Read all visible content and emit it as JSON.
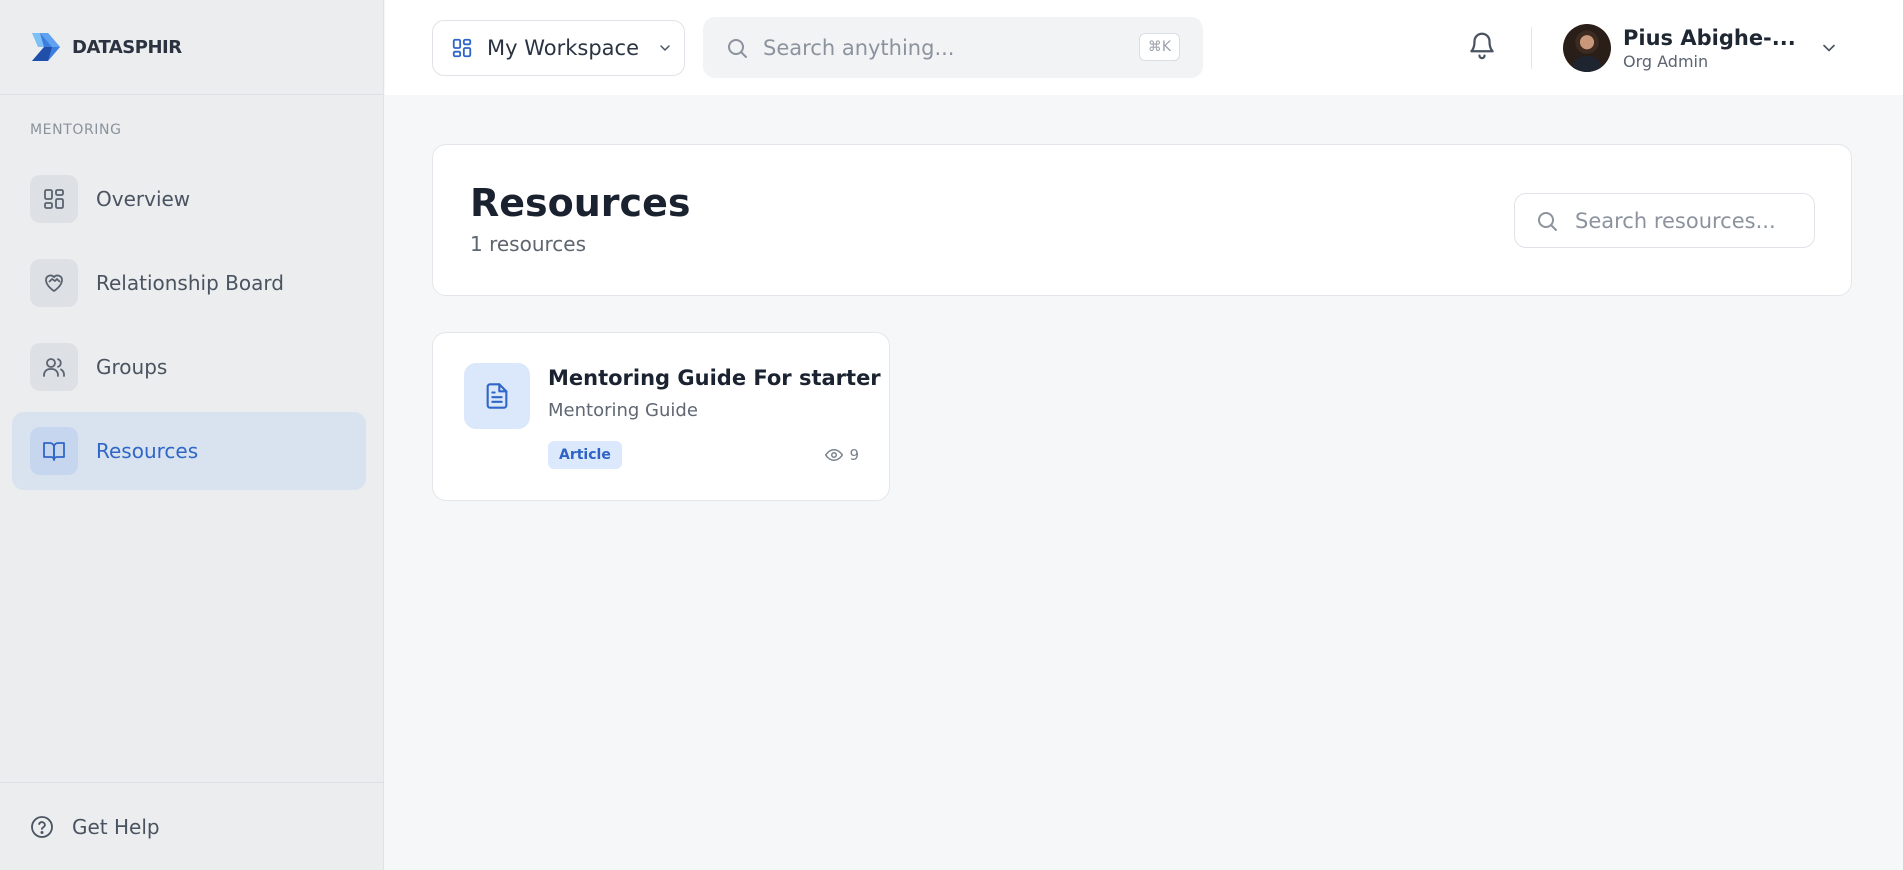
{
  "brand": {
    "name": "DATASPHIR",
    "accent": "#2f66c7"
  },
  "sidebar": {
    "section_label": "MENTORING",
    "items": [
      {
        "label": "Overview",
        "icon": "dashboard-grid-icon",
        "active": false
      },
      {
        "label": "Relationship Board",
        "icon": "heart-handshake-icon",
        "active": false
      },
      {
        "label": "Groups",
        "icon": "users-icon",
        "active": false
      },
      {
        "label": "Resources",
        "icon": "book-open-icon",
        "active": true
      }
    ],
    "footer": {
      "label": "Get Help",
      "icon": "help-circle-icon"
    }
  },
  "header": {
    "workspace_label": "My Workspace",
    "search_placeholder": "Search anything...",
    "search_shortcut": "⌘K",
    "user": {
      "name": "Pius Abighe-...",
      "role": "Org Admin"
    }
  },
  "main": {
    "title": "Resources",
    "count_text": "1 resources",
    "search_placeholder": "Search resources...",
    "cards": [
      {
        "title": "Mentoring Guide For starter",
        "subtitle": "Mentoring Guide",
        "badge": "Article",
        "views": "9",
        "icon": "document-icon"
      }
    ]
  }
}
